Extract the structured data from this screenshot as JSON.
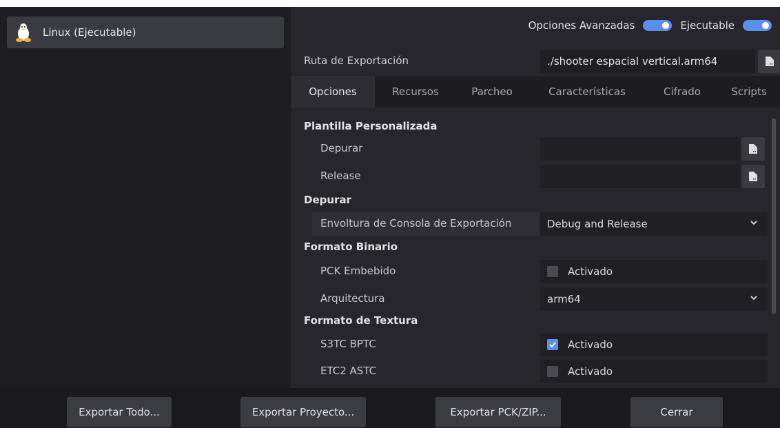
{
  "presets": {
    "items": [
      {
        "label": "Linux (Ejecutable)",
        "icon": "tux-icon"
      }
    ]
  },
  "header": {
    "advanced_label": "Opciones Avanzadas",
    "advanced_on": true,
    "runnable_label": "Ejecutable",
    "runnable_on": true,
    "export_path_label": "Ruta de Exportación",
    "export_path_value": "./shooter espacial vertical.arm64"
  },
  "tabs": [
    {
      "label": "Opciones",
      "active": true
    },
    {
      "label": "Recursos",
      "active": false
    },
    {
      "label": "Parcheo",
      "active": false
    },
    {
      "label": "Características",
      "active": false
    },
    {
      "label": "Cifrado",
      "active": false
    },
    {
      "label": "Scripts",
      "active": false
    }
  ],
  "options": {
    "custom_template": {
      "title": "Plantilla Personalizada",
      "debug_label": "Depurar",
      "debug_value": "",
      "release_label": "Release",
      "release_value": ""
    },
    "debug": {
      "title": "Depurar",
      "console_wrapper_label": "Envoltura de Consola de Exportación",
      "console_wrapper_value": "Debug and Release"
    },
    "binary_format": {
      "title": "Formato Binario",
      "embed_pck_label": "PCK Embebido",
      "embed_pck_value": "Activado",
      "embed_pck_checked": false,
      "architecture_label": "Arquitectura",
      "architecture_value": "arm64"
    },
    "texture_format": {
      "title": "Formato de Textura",
      "s3tc_label": "S3TC BPTC",
      "s3tc_value": "Activado",
      "s3tc_checked": true,
      "etc2_label": "ETC2 ASTC",
      "etc2_value": "Activado",
      "etc2_checked": false
    }
  },
  "footer": {
    "export_all": "Exportar Todo...",
    "export_project": "Exportar Proyecto...",
    "export_pck": "Exportar PCK/ZIP...",
    "close": "Cerrar"
  },
  "colors": {
    "accent": "#5a8ff0",
    "panel": "#26262c",
    "background": "#1c1c21"
  }
}
